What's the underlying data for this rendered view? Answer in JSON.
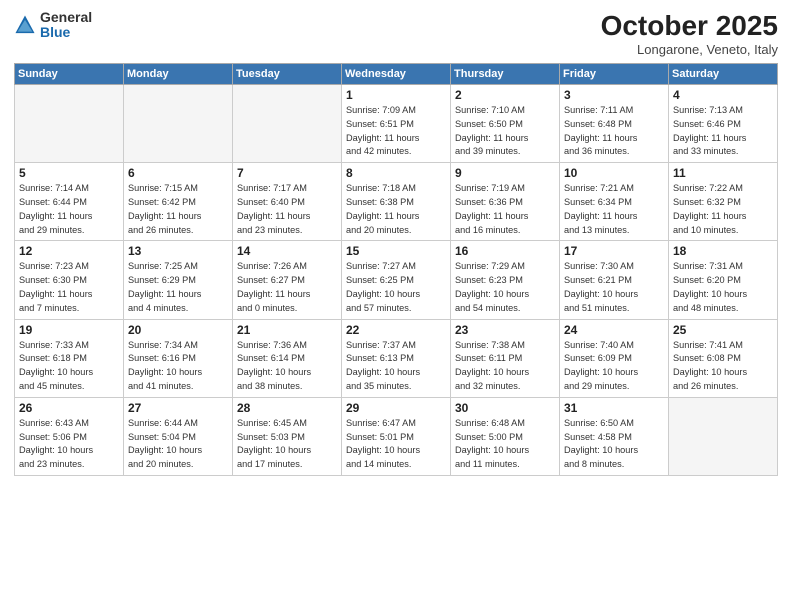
{
  "header": {
    "logo_general": "General",
    "logo_blue": "Blue",
    "month": "October 2025",
    "location": "Longarone, Veneto, Italy"
  },
  "weekdays": [
    "Sunday",
    "Monday",
    "Tuesday",
    "Wednesday",
    "Thursday",
    "Friday",
    "Saturday"
  ],
  "weeks": [
    [
      {
        "day": "",
        "info": ""
      },
      {
        "day": "",
        "info": ""
      },
      {
        "day": "",
        "info": ""
      },
      {
        "day": "1",
        "info": "Sunrise: 7:09 AM\nSunset: 6:51 PM\nDaylight: 11 hours\nand 42 minutes."
      },
      {
        "day": "2",
        "info": "Sunrise: 7:10 AM\nSunset: 6:50 PM\nDaylight: 11 hours\nand 39 minutes."
      },
      {
        "day": "3",
        "info": "Sunrise: 7:11 AM\nSunset: 6:48 PM\nDaylight: 11 hours\nand 36 minutes."
      },
      {
        "day": "4",
        "info": "Sunrise: 7:13 AM\nSunset: 6:46 PM\nDaylight: 11 hours\nand 33 minutes."
      }
    ],
    [
      {
        "day": "5",
        "info": "Sunrise: 7:14 AM\nSunset: 6:44 PM\nDaylight: 11 hours\nand 29 minutes."
      },
      {
        "day": "6",
        "info": "Sunrise: 7:15 AM\nSunset: 6:42 PM\nDaylight: 11 hours\nand 26 minutes."
      },
      {
        "day": "7",
        "info": "Sunrise: 7:17 AM\nSunset: 6:40 PM\nDaylight: 11 hours\nand 23 minutes."
      },
      {
        "day": "8",
        "info": "Sunrise: 7:18 AM\nSunset: 6:38 PM\nDaylight: 11 hours\nand 20 minutes."
      },
      {
        "day": "9",
        "info": "Sunrise: 7:19 AM\nSunset: 6:36 PM\nDaylight: 11 hours\nand 16 minutes."
      },
      {
        "day": "10",
        "info": "Sunrise: 7:21 AM\nSunset: 6:34 PM\nDaylight: 11 hours\nand 13 minutes."
      },
      {
        "day": "11",
        "info": "Sunrise: 7:22 AM\nSunset: 6:32 PM\nDaylight: 11 hours\nand 10 minutes."
      }
    ],
    [
      {
        "day": "12",
        "info": "Sunrise: 7:23 AM\nSunset: 6:30 PM\nDaylight: 11 hours\nand 7 minutes."
      },
      {
        "day": "13",
        "info": "Sunrise: 7:25 AM\nSunset: 6:29 PM\nDaylight: 11 hours\nand 4 minutes."
      },
      {
        "day": "14",
        "info": "Sunrise: 7:26 AM\nSunset: 6:27 PM\nDaylight: 11 hours\nand 0 minutes."
      },
      {
        "day": "15",
        "info": "Sunrise: 7:27 AM\nSunset: 6:25 PM\nDaylight: 10 hours\nand 57 minutes."
      },
      {
        "day": "16",
        "info": "Sunrise: 7:29 AM\nSunset: 6:23 PM\nDaylight: 10 hours\nand 54 minutes."
      },
      {
        "day": "17",
        "info": "Sunrise: 7:30 AM\nSunset: 6:21 PM\nDaylight: 10 hours\nand 51 minutes."
      },
      {
        "day": "18",
        "info": "Sunrise: 7:31 AM\nSunset: 6:20 PM\nDaylight: 10 hours\nand 48 minutes."
      }
    ],
    [
      {
        "day": "19",
        "info": "Sunrise: 7:33 AM\nSunset: 6:18 PM\nDaylight: 10 hours\nand 45 minutes."
      },
      {
        "day": "20",
        "info": "Sunrise: 7:34 AM\nSunset: 6:16 PM\nDaylight: 10 hours\nand 41 minutes."
      },
      {
        "day": "21",
        "info": "Sunrise: 7:36 AM\nSunset: 6:14 PM\nDaylight: 10 hours\nand 38 minutes."
      },
      {
        "day": "22",
        "info": "Sunrise: 7:37 AM\nSunset: 6:13 PM\nDaylight: 10 hours\nand 35 minutes."
      },
      {
        "day": "23",
        "info": "Sunrise: 7:38 AM\nSunset: 6:11 PM\nDaylight: 10 hours\nand 32 minutes."
      },
      {
        "day": "24",
        "info": "Sunrise: 7:40 AM\nSunset: 6:09 PM\nDaylight: 10 hours\nand 29 minutes."
      },
      {
        "day": "25",
        "info": "Sunrise: 7:41 AM\nSunset: 6:08 PM\nDaylight: 10 hours\nand 26 minutes."
      }
    ],
    [
      {
        "day": "26",
        "info": "Sunrise: 6:43 AM\nSunset: 5:06 PM\nDaylight: 10 hours\nand 23 minutes."
      },
      {
        "day": "27",
        "info": "Sunrise: 6:44 AM\nSunset: 5:04 PM\nDaylight: 10 hours\nand 20 minutes."
      },
      {
        "day": "28",
        "info": "Sunrise: 6:45 AM\nSunset: 5:03 PM\nDaylight: 10 hours\nand 17 minutes."
      },
      {
        "day": "29",
        "info": "Sunrise: 6:47 AM\nSunset: 5:01 PM\nDaylight: 10 hours\nand 14 minutes."
      },
      {
        "day": "30",
        "info": "Sunrise: 6:48 AM\nSunset: 5:00 PM\nDaylight: 10 hours\nand 11 minutes."
      },
      {
        "day": "31",
        "info": "Sunrise: 6:50 AM\nSunset: 4:58 PM\nDaylight: 10 hours\nand 8 minutes."
      },
      {
        "day": "",
        "info": ""
      }
    ]
  ]
}
